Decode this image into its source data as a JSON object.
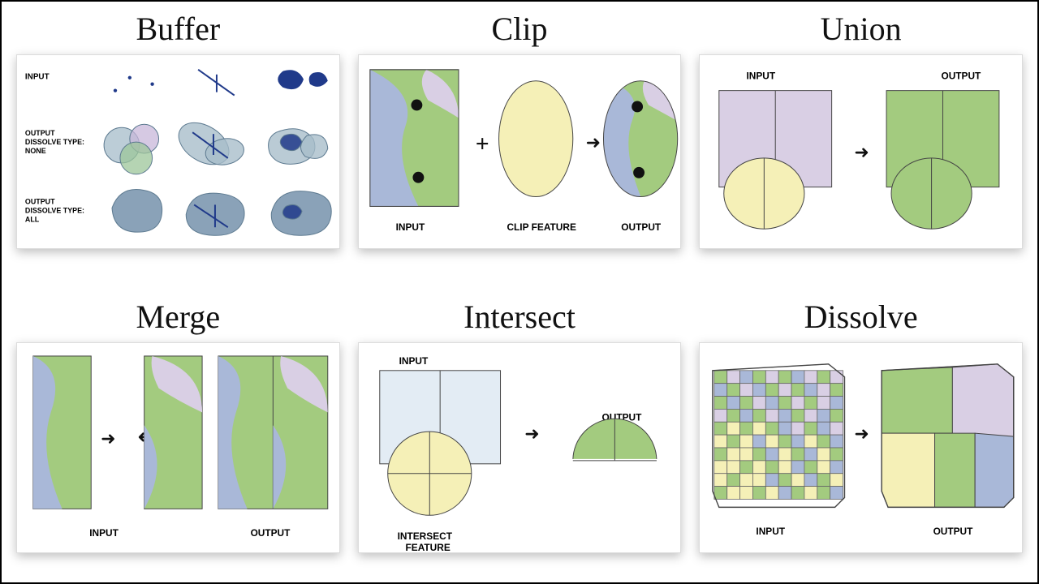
{
  "panels": {
    "buffer": {
      "title": "Buffer",
      "labels": {
        "input": "INPUT",
        "dissolveNone": "OUTPUT\nDISSOLVE TYPE:\nNONE",
        "dissolveAll": "OUTPUT\nDISSOLVE TYPE:\nALL"
      }
    },
    "clip": {
      "title": "Clip",
      "labels": {
        "input": "INPUT",
        "feature": "CLIP FEATURE",
        "output": "OUTPUT"
      },
      "symbols": {
        "plus": "+",
        "arrow": "►"
      }
    },
    "union": {
      "title": "Union",
      "labels": {
        "input": "INPUT",
        "output": "OUTPUT"
      },
      "symbols": {
        "arrow": "►"
      }
    },
    "merge": {
      "title": "Merge",
      "labels": {
        "input": "INPUT",
        "output": "OUTPUT"
      },
      "symbols": {
        "arrowR": "►",
        "arrowL": "◄"
      }
    },
    "intersect": {
      "title": "Intersect",
      "labels": {
        "input": "INPUT",
        "feature": "INTERSECT\nFEATURE",
        "output": "OUTPUT"
      },
      "symbols": {
        "arrow": "►"
      }
    },
    "dissolve": {
      "title": "Dissolve",
      "labels": {
        "input": "INPUT",
        "output": "OUTPUT"
      },
      "symbols": {
        "arrow": "►"
      }
    }
  },
  "colors": {
    "green": "#a3cb7f",
    "blue": "#a9b8d8",
    "lavender": "#d9cfe4",
    "cream": "#f5f0b7",
    "navy": "#203a8a",
    "slate": "#7d98b0",
    "slateLt": "#a6bcc9",
    "paleBlue": "#e3ecf4",
    "ink": "#111"
  }
}
